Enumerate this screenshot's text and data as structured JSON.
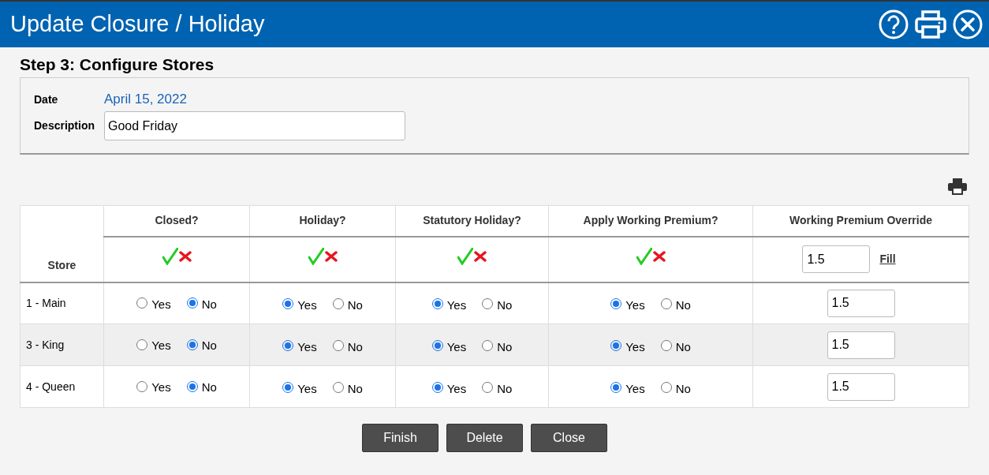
{
  "window": {
    "title": "Update Closure / Holiday"
  },
  "step_title": "Step 3: Configure Stores",
  "form": {
    "date_label": "Date",
    "date_value": "April 15, 2022",
    "description_label": "Description",
    "description_value": "Good Friday"
  },
  "table": {
    "store_header": "Store",
    "columns": [
      "Closed?",
      "Holiday?",
      "Statutory Holiday?",
      "Apply Working Premium?"
    ],
    "override_header": "Working Premium Override",
    "override_fill_value": "1.5",
    "fill_link": "Fill",
    "rows": [
      {
        "store": "1 - Main",
        "choices": [
          [
            {
              "label": "Yes",
              "selected": false
            },
            {
              "label": "No",
              "selected": true
            }
          ],
          [
            {
              "label": "Yes",
              "selected": true
            },
            {
              "label": "No",
              "selected": false
            }
          ],
          [
            {
              "label": "Yes",
              "selected": true
            },
            {
              "label": "No",
              "selected": false
            }
          ],
          [
            {
              "label": "Yes",
              "selected": true
            },
            {
              "label": "No",
              "selected": false
            }
          ]
        ],
        "override": "1.5"
      },
      {
        "store": "3 - King",
        "choices": [
          [
            {
              "label": "Yes",
              "selected": false
            },
            {
              "label": "No",
              "selected": true
            }
          ],
          [
            {
              "label": "Yes",
              "selected": true
            },
            {
              "label": "No",
              "selected": false
            }
          ],
          [
            {
              "label": "Yes",
              "selected": true
            },
            {
              "label": "No",
              "selected": false
            }
          ],
          [
            {
              "label": "Yes",
              "selected": true
            },
            {
              "label": "No",
              "selected": false
            }
          ]
        ],
        "override": "1.5"
      },
      {
        "store": "4 - Queen",
        "choices": [
          [
            {
              "label": "Yes",
              "selected": false
            },
            {
              "label": "No",
              "selected": true
            }
          ],
          [
            {
              "label": "Yes",
              "selected": true
            },
            {
              "label": "No",
              "selected": false
            }
          ],
          [
            {
              "label": "Yes",
              "selected": true
            },
            {
              "label": "No",
              "selected": false
            }
          ],
          [
            {
              "label": "Yes",
              "selected": true
            },
            {
              "label": "No",
              "selected": false
            }
          ]
        ],
        "override": "1.5"
      }
    ]
  },
  "buttons": [
    "Finish",
    "Delete",
    "Close"
  ]
}
